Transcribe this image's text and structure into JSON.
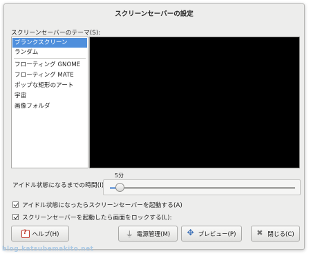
{
  "window": {
    "title": "スクリーンセーバーの設定"
  },
  "theme_section": {
    "label": "スクリーンセーバーのテーマ(S):",
    "items": [
      {
        "label": "ブランクスクリーン",
        "selected": true
      },
      {
        "label": "ランダム",
        "selected": false
      },
      {
        "label": "フローティング GNOME",
        "selected": false
      },
      {
        "label": "フローティング MATE",
        "selected": false
      },
      {
        "label": "ポップな矩形のアート",
        "selected": false
      },
      {
        "label": "宇宙",
        "selected": false
      },
      {
        "label": "画像フォルダ",
        "selected": false
      }
    ]
  },
  "idle": {
    "label": "アイドル状態になるまでの時間(I):",
    "value_label": "5分",
    "fraction": 0.0
  },
  "options": {
    "activate_label": "アイドル状態になったらスクリーンセーバーを起動する(A)",
    "activate_checked": true,
    "lock_label": "スクリーンセーバーを起動したら画面をロックする(L):",
    "lock_checked": true
  },
  "buttons": {
    "help": "ヘルプ(H)",
    "power": "電源管理(M)",
    "preview": "プレビュー(P)",
    "close": "閉じる(C)"
  },
  "watermark": "blog.katsubemakito.net",
  "colors": {
    "selection": "#4f8fdc",
    "preview_bg": "#000000"
  }
}
